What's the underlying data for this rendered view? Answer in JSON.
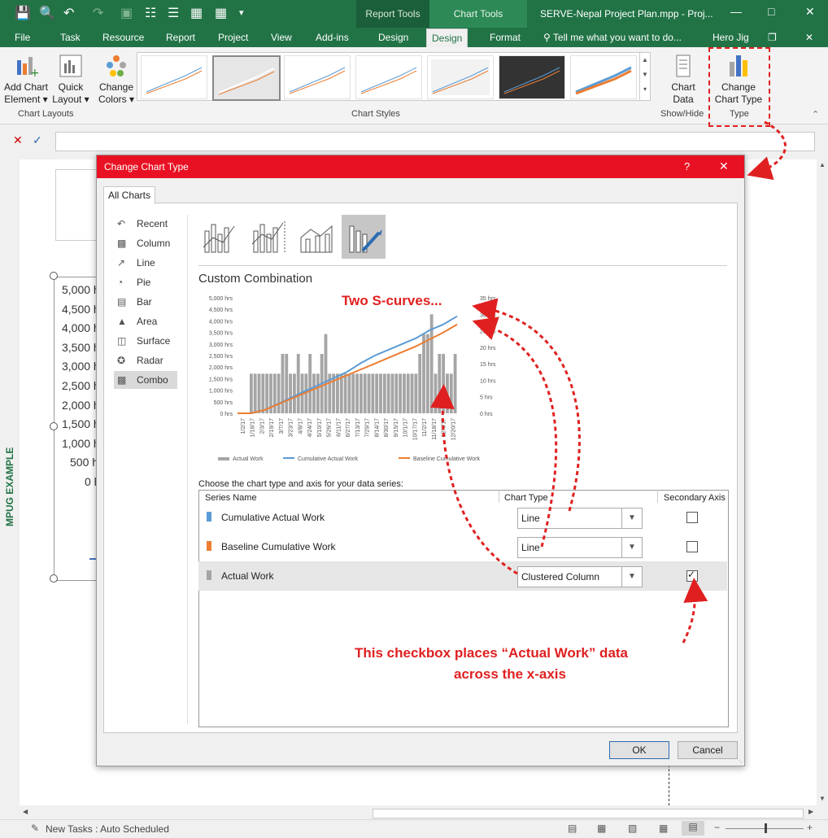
{
  "window": {
    "context_report_tools": "Report Tools",
    "context_chart_tools": "Chart Tools",
    "doc_title": "SERVE-Nepal Project Plan.mpp - Proj...",
    "user": "Hero Jig"
  },
  "tabs": {
    "file": "File",
    "task": "Task",
    "resource": "Resource",
    "report": "Report",
    "project": "Project",
    "view": "View",
    "addins": "Add-ins",
    "design1": "Design",
    "design2": "Design",
    "format": "Format",
    "tell_me": "Tell me what you want to do..."
  },
  "ribbon": {
    "add_chart_element": "Add Chart\nElement",
    "add_chart_element_l1": "Add Chart",
    "add_chart_element_l2": "Element",
    "quick_layout_l1": "Quick",
    "quick_layout_l2": "Layout",
    "change_colors_l1": "Change",
    "change_colors_l2": "Colors",
    "chart_data_l1": "Chart",
    "chart_data_l2": "Data",
    "change_chart_type_l1": "Change",
    "change_chart_type_l2": "Chart Type",
    "group_chart_layouts": "Chart Layouts",
    "group_chart_styles": "Chart Styles",
    "group_show_hide": "Show/Hide",
    "group_type": "Type"
  },
  "workspace": {
    "side_label": "MPUG EXAMPLE",
    "y_ticks": [
      "5,000 h",
      "4,500 h",
      "4,000 h",
      "3,500 h",
      "3,000 h",
      "2,500 h",
      "2,000 h",
      "1,500 h",
      "1,000 h",
      "500 h",
      "0 h"
    ]
  },
  "dialog": {
    "title": "Change Chart Type",
    "help": "?",
    "tab_all_charts": "All Charts",
    "categories": [
      "Recent",
      "Column",
      "Line",
      "Pie",
      "Bar",
      "Area",
      "Surface",
      "Radar",
      "Combo"
    ],
    "heading": "Custom Combination",
    "choose_text": "Choose the chart type and axis for your data series:",
    "col_series": "Series Name",
    "col_type": "Chart Type",
    "col_secondary": "Secondary Axis",
    "series": [
      {
        "name": "Cumulative Actual Work",
        "type": "Line",
        "secondary": false,
        "color": "#5b9bd5"
      },
      {
        "name": "Baseline Cumulative Work",
        "type": "Line",
        "secondary": false,
        "color": "#ed7d31"
      },
      {
        "name": "Actual Work",
        "type": "Clustered Column",
        "secondary": true,
        "color": "#a5a5a5"
      }
    ],
    "ok": "OK",
    "cancel": "Cancel"
  },
  "annotations": {
    "s_curves": "Two S-curves...",
    "checkbox_note_l1": "This checkbox places “Actual Work” data",
    "checkbox_note_l2": "across the x-axis"
  },
  "status": {
    "new_tasks": "New Tasks : Auto Scheduled"
  },
  "chart_data": {
    "type": "bar",
    "y_ticks_left": [
      "5,000 hrs",
      "4,500 hrs",
      "4,000 hrs",
      "3,500 hrs",
      "3,000 hrs",
      "2,500 hrs",
      "2,000 hrs",
      "1,500 hrs",
      "1,000 hrs",
      "500 hrs",
      "0 hrs"
    ],
    "y_ticks_right": [
      "35 hrs",
      "30 hrs",
      "25 hrs",
      "20 hrs",
      "15 hrs",
      "10 hrs",
      "5 hrs",
      "0 hrs"
    ],
    "ylim_left": [
      0,
      5000
    ],
    "ylim_right": [
      0,
      35
    ],
    "categories": [
      "1/2/17",
      "1/18/17",
      "2/3/17",
      "2/19/17",
      "3/7/17",
      "3/23/17",
      "4/8/17",
      "4/24/17",
      "5/10/17",
      "5/26/17",
      "6/11/17",
      "6/27/17",
      "7/13/17",
      "7/29/17",
      "8/14/17",
      "8/30/17",
      "9/15/17",
      "10/1/17",
      "10/17/17",
      "11/2/17",
      "11/18/17",
      "12/4/17",
      "12/20/17"
    ],
    "series": [
      {
        "name": "Actual Work",
        "axis": "secondary",
        "kind": "column",
        "values": [
          0,
          0,
          0,
          12,
          12,
          12,
          12,
          12,
          12,
          12,
          12,
          18,
          18,
          12,
          12,
          18,
          12,
          12,
          18,
          12,
          12,
          18,
          24,
          12,
          12,
          12,
          12,
          12,
          12,
          12,
          12,
          12,
          12,
          12,
          12,
          12,
          12,
          12,
          12,
          12,
          12,
          12,
          12,
          12,
          12,
          12,
          18,
          24,
          24,
          30,
          12,
          18,
          18,
          12,
          12,
          18
        ]
      },
      {
        "name": "Cumulative Actual Work",
        "axis": "primary",
        "kind": "line",
        "values": [
          0,
          0,
          150,
          420,
          700,
          980,
          1250,
          1520,
          1800,
          2180,
          2500,
          2750,
          3000,
          3250,
          3600,
          3850,
          4200
        ]
      },
      {
        "name": "Baseline Cumulative Work",
        "axis": "primary",
        "kind": "line",
        "values": [
          0,
          0,
          150,
          400,
          650,
          900,
          1150,
          1400,
          1650,
          1900,
          2150,
          2400,
          2650,
          2900,
          3200,
          3500,
          3850
        ]
      }
    ],
    "legend": "bottom"
  }
}
